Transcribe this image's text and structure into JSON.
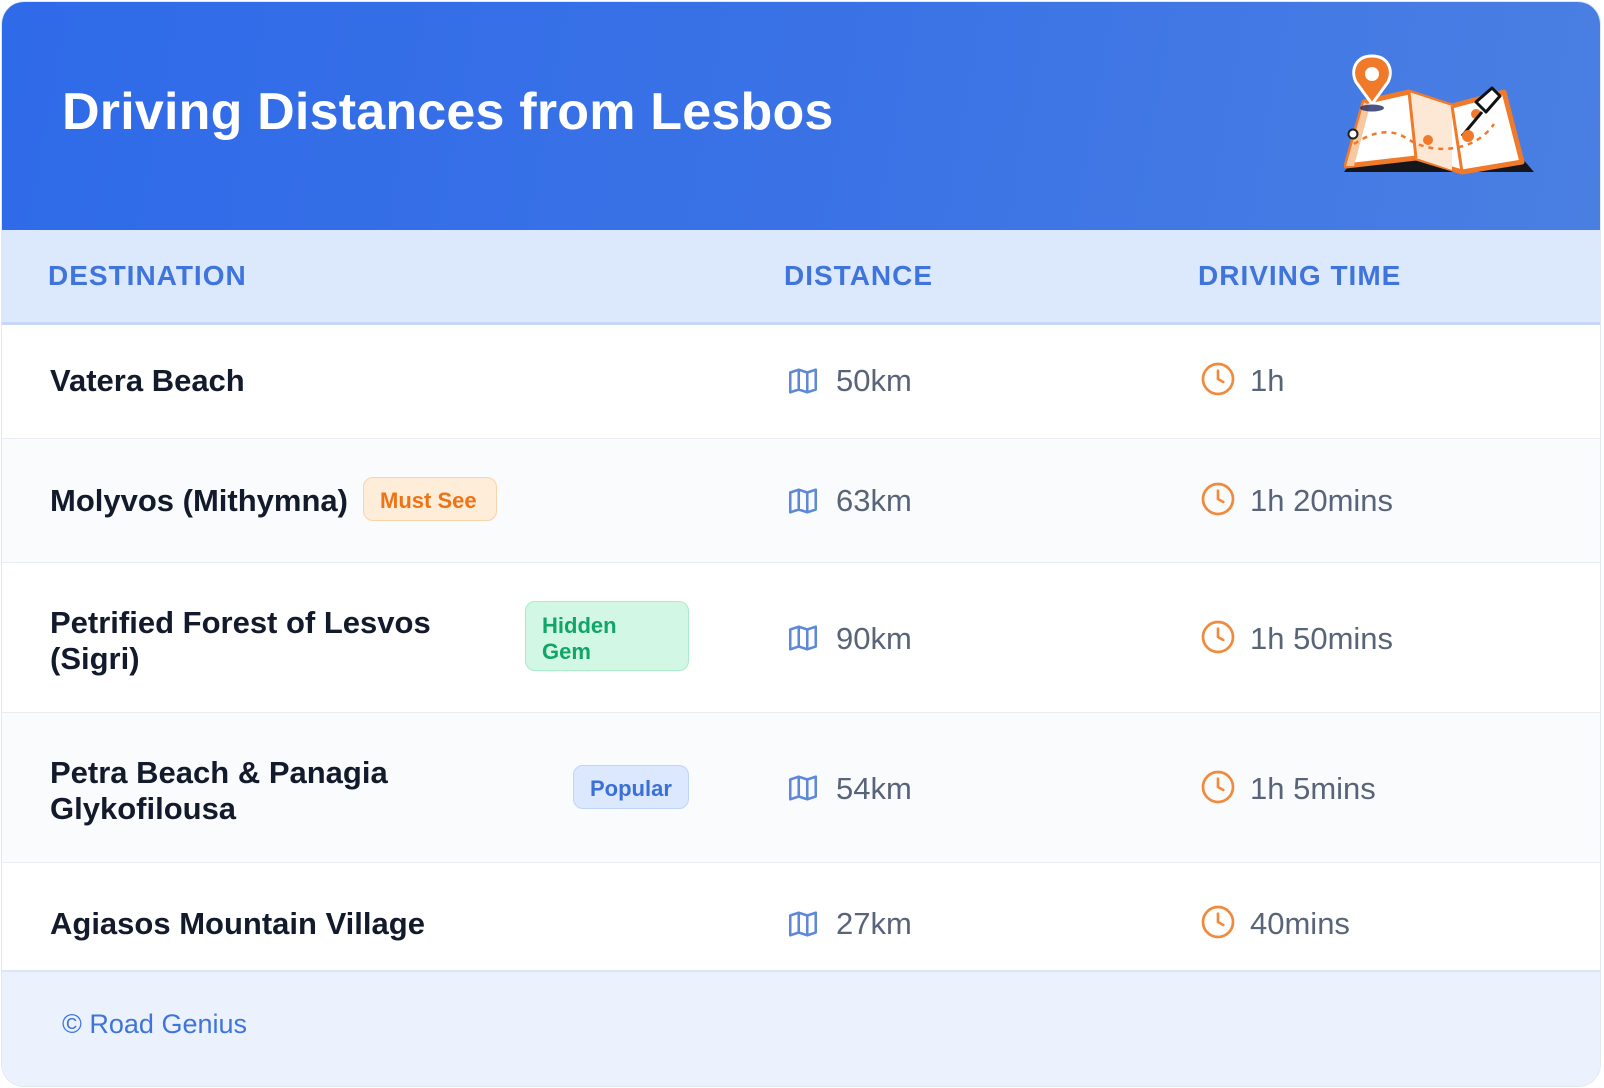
{
  "header": {
    "title": "Driving Distances from Lesbos",
    "illustration_icon": "folded-map-with-pins-icon"
  },
  "columns": {
    "destination": "DESTINATION",
    "distance": "DISTANCE",
    "driving_time": "DRIVING TIME"
  },
  "rows": [
    {
      "destination": "Vatera Beach",
      "badge": "",
      "distance": "50km",
      "time": "1h"
    },
    {
      "destination": "Molyvos (Mithymna)",
      "badge": "Must See",
      "distance": "63km",
      "time": "1h 20mins"
    },
    {
      "destination_lines": [
        "Petrified Forest of Lesvos",
        "(Sigri)"
      ],
      "badge_lines": [
        "Hidden",
        "Gem"
      ],
      "distance": "90km",
      "time": "1h 50mins"
    },
    {
      "destination_lines": [
        "Petra Beach & Panagia",
        "Glykofilousa"
      ],
      "badge": "Popular",
      "distance": "54km",
      "time": "1h 5mins"
    },
    {
      "destination": "Agiasos Mountain Village",
      "badge": "",
      "distance": "27km",
      "time": "40mins"
    }
  ],
  "icons": {
    "distance": "map-icon",
    "time": "clock-icon"
  },
  "footer": {
    "copyright": "© Road Genius"
  },
  "colors": {
    "header_gradient_start": "#2f6ae8",
    "header_gradient_end": "#4a7fe2",
    "accent_blue": "#3f74dc",
    "accent_orange": "#ef7316",
    "accent_green": "#12a56a"
  }
}
